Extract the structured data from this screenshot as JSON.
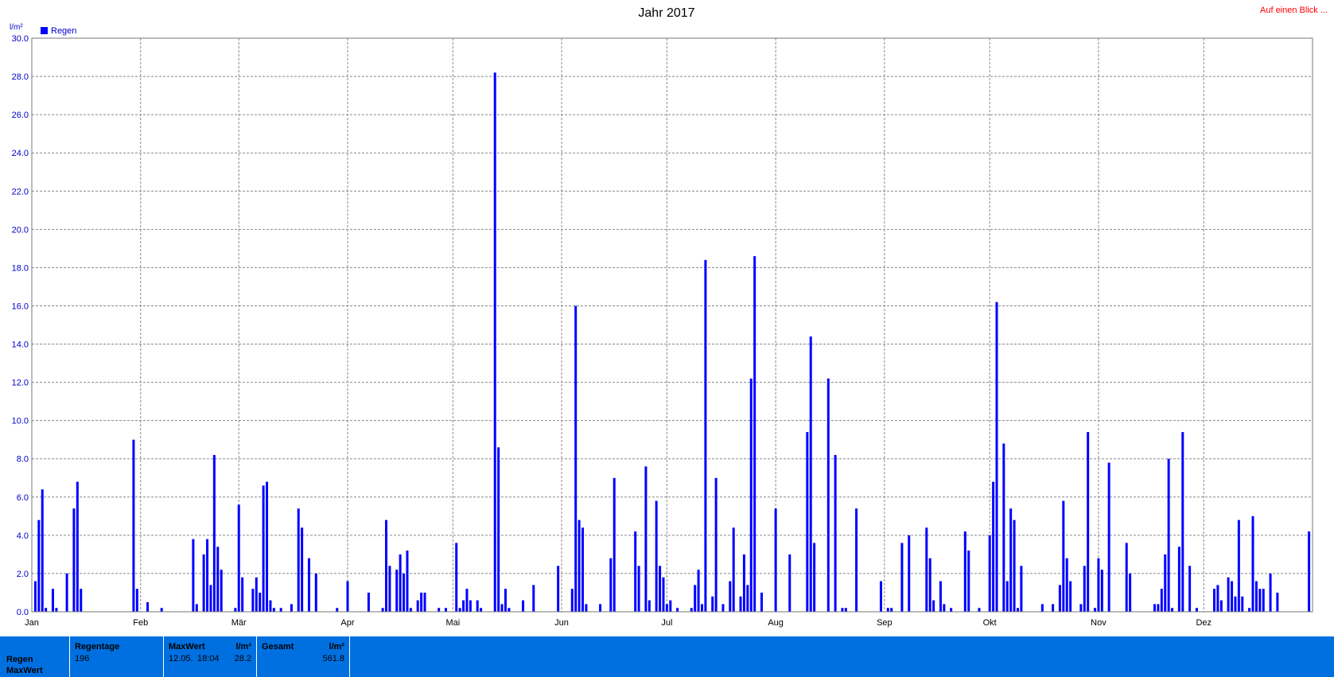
{
  "header": {
    "title": "Jahr 2017",
    "top_link": "Auf einen Blick ..."
  },
  "colors": {
    "bar": "#0000ff",
    "axis_text": "#0000cc",
    "grid": "#888888",
    "link": "#ff0000",
    "stats_bg": "#0070e0"
  },
  "chart_data": {
    "type": "bar",
    "title": "Jahr 2017",
    "ylabel": "l/m²",
    "xlabel": "",
    "ylim": [
      0,
      30
    ],
    "yticks": [
      "0.0",
      "2.0",
      "4.0",
      "6.0",
      "8.0",
      "10.0",
      "12.0",
      "14.0",
      "16.0",
      "18.0",
      "20.0",
      "22.0",
      "24.0",
      "26.0",
      "28.0",
      "30.0"
    ],
    "x_domain_days": [
      1,
      366
    ],
    "xticks": [
      {
        "label": "Jan",
        "day": 1
      },
      {
        "label": "Feb",
        "day": 32
      },
      {
        "label": "Mär",
        "day": 60
      },
      {
        "label": "Apr",
        "day": 91
      },
      {
        "label": "Mai",
        "day": 121
      },
      {
        "label": "Jun",
        "day": 152
      },
      {
        "label": "Jul",
        "day": 182
      },
      {
        "label": "Aug",
        "day": 213
      },
      {
        "label": "Sep",
        "day": 244
      },
      {
        "label": "Okt",
        "day": 274
      },
      {
        "label": "Nov",
        "day": 305
      },
      {
        "label": "Dez",
        "day": 335
      }
    ],
    "legend": {
      "position": "top-left"
    },
    "grid": true,
    "series": [
      {
        "name": "Regen",
        "color": "#0000ff",
        "points": [
          [
            2,
            1.6
          ],
          [
            3,
            4.8
          ],
          [
            4,
            6.4
          ],
          [
            5,
            0.2
          ],
          [
            7,
            1.2
          ],
          [
            8,
            0.2
          ],
          [
            11,
            2.0
          ],
          [
            13,
            5.4
          ],
          [
            14,
            6.8
          ],
          [
            15,
            1.2
          ],
          [
            30,
            9.0
          ],
          [
            31,
            1.2
          ],
          [
            34,
            0.5
          ],
          [
            38,
            0.2
          ],
          [
            47,
            3.8
          ],
          [
            48,
            0.4
          ],
          [
            50,
            3.0
          ],
          [
            51,
            3.8
          ],
          [
            52,
            1.4
          ],
          [
            53,
            8.2
          ],
          [
            54,
            3.4
          ],
          [
            55,
            2.2
          ],
          [
            59,
            0.2
          ],
          [
            60,
            5.6
          ],
          [
            61,
            1.8
          ],
          [
            64,
            1.2
          ],
          [
            65,
            1.8
          ],
          [
            66,
            1.0
          ],
          [
            67,
            6.6
          ],
          [
            68,
            6.8
          ],
          [
            69,
            0.6
          ],
          [
            70,
            0.2
          ],
          [
            72,
            0.2
          ],
          [
            75,
            0.4
          ],
          [
            77,
            5.4
          ],
          [
            78,
            4.4
          ],
          [
            80,
            2.8
          ],
          [
            82,
            2.0
          ],
          [
            88,
            0.2
          ],
          [
            91,
            1.6
          ],
          [
            97,
            1.0
          ],
          [
            101,
            0.2
          ],
          [
            102,
            4.8
          ],
          [
            103,
            2.4
          ],
          [
            105,
            2.2
          ],
          [
            106,
            3.0
          ],
          [
            107,
            2.0
          ],
          [
            108,
            3.2
          ],
          [
            109,
            0.2
          ],
          [
            111,
            0.6
          ],
          [
            112,
            1.0
          ],
          [
            113,
            1.0
          ],
          [
            117,
            0.2
          ],
          [
            119,
            0.2
          ],
          [
            122,
            3.6
          ],
          [
            123,
            0.2
          ],
          [
            124,
            0.6
          ],
          [
            125,
            1.2
          ],
          [
            126,
            0.6
          ],
          [
            128,
            0.6
          ],
          [
            129,
            0.2
          ],
          [
            133,
            28.2
          ],
          [
            134,
            8.6
          ],
          [
            135,
            0.4
          ],
          [
            136,
            1.2
          ],
          [
            137,
            0.2
          ],
          [
            141,
            0.6
          ],
          [
            144,
            1.4
          ],
          [
            151,
            2.4
          ],
          [
            155,
            1.2
          ],
          [
            156,
            16.0
          ],
          [
            157,
            4.8
          ],
          [
            158,
            4.4
          ],
          [
            159,
            0.4
          ],
          [
            163,
            0.4
          ],
          [
            166,
            2.8
          ],
          [
            167,
            7.0
          ],
          [
            173,
            4.2
          ],
          [
            174,
            2.4
          ],
          [
            176,
            7.6
          ],
          [
            177,
            0.6
          ],
          [
            179,
            5.8
          ],
          [
            180,
            2.4
          ],
          [
            181,
            1.8
          ],
          [
            182,
            0.4
          ],
          [
            183,
            0.6
          ],
          [
            185,
            0.2
          ],
          [
            189,
            0.2
          ],
          [
            190,
            1.4
          ],
          [
            191,
            2.2
          ],
          [
            192,
            0.4
          ],
          [
            193,
            18.4
          ],
          [
            195,
            0.8
          ],
          [
            196,
            7.0
          ],
          [
            198,
            0.4
          ],
          [
            200,
            1.6
          ],
          [
            201,
            4.4
          ],
          [
            203,
            0.8
          ],
          [
            204,
            3.0
          ],
          [
            205,
            1.4
          ],
          [
            206,
            12.2
          ],
          [
            207,
            18.6
          ],
          [
            209,
            1.0
          ],
          [
            213,
            5.4
          ],
          [
            217,
            3.0
          ],
          [
            222,
            9.4
          ],
          [
            223,
            14.4
          ],
          [
            224,
            3.6
          ],
          [
            228,
            12.2
          ],
          [
            230,
            8.2
          ],
          [
            232,
            0.2
          ],
          [
            233,
            0.2
          ],
          [
            236,
            5.4
          ],
          [
            243,
            1.6
          ],
          [
            245,
            0.2
          ],
          [
            246,
            0.2
          ],
          [
            249,
            3.6
          ],
          [
            251,
            4.0
          ],
          [
            256,
            4.4
          ],
          [
            257,
            2.8
          ],
          [
            258,
            0.6
          ],
          [
            260,
            1.6
          ],
          [
            261,
            0.4
          ],
          [
            263,
            0.2
          ],
          [
            267,
            4.2
          ],
          [
            268,
            3.2
          ],
          [
            271,
            0.2
          ],
          [
            274,
            4.0
          ],
          [
            275,
            6.8
          ],
          [
            276,
            16.2
          ],
          [
            278,
            8.8
          ],
          [
            279,
            1.6
          ],
          [
            280,
            5.4
          ],
          [
            281,
            4.8
          ],
          [
            282,
            0.2
          ],
          [
            283,
            2.4
          ],
          [
            289,
            0.4
          ],
          [
            292,
            0.4
          ],
          [
            294,
            1.4
          ],
          [
            295,
            5.8
          ],
          [
            296,
            2.8
          ],
          [
            297,
            1.6
          ],
          [
            300,
            0.4
          ],
          [
            301,
            2.4
          ],
          [
            302,
            9.4
          ],
          [
            304,
            0.2
          ],
          [
            305,
            2.8
          ],
          [
            306,
            2.2
          ],
          [
            308,
            7.8
          ],
          [
            313,
            3.6
          ],
          [
            314,
            2.0
          ],
          [
            321,
            0.4
          ],
          [
            322,
            0.4
          ],
          [
            323,
            1.2
          ],
          [
            324,
            3.0
          ],
          [
            325,
            8.0
          ],
          [
            326,
            0.2
          ],
          [
            328,
            3.4
          ],
          [
            329,
            9.4
          ],
          [
            331,
            2.4
          ],
          [
            333,
            0.2
          ],
          [
            338,
            1.2
          ],
          [
            339,
            1.4
          ],
          [
            340,
            0.6
          ],
          [
            342,
            1.8
          ],
          [
            343,
            1.6
          ],
          [
            344,
            0.8
          ],
          [
            345,
            4.8
          ],
          [
            346,
            0.8
          ],
          [
            348,
            0.2
          ],
          [
            349,
            5.0
          ],
          [
            350,
            1.6
          ],
          [
            351,
            1.2
          ],
          [
            352,
            1.2
          ],
          [
            354,
            2.0
          ],
          [
            356,
            1.0
          ],
          [
            365,
            4.2
          ]
        ]
      }
    ]
  },
  "stats": {
    "row_label": "Regen",
    "row_label2": "MaxWert",
    "regentage": {
      "label": "Regentage",
      "value": "196"
    },
    "maxwert": {
      "label": "MaxWert",
      "unit": "l/m²",
      "date": "12.05.",
      "time": "18:04",
      "value": "28.2"
    },
    "gesamt": {
      "label": "Gesamt",
      "unit": "l/m²",
      "value": "561.8"
    }
  }
}
